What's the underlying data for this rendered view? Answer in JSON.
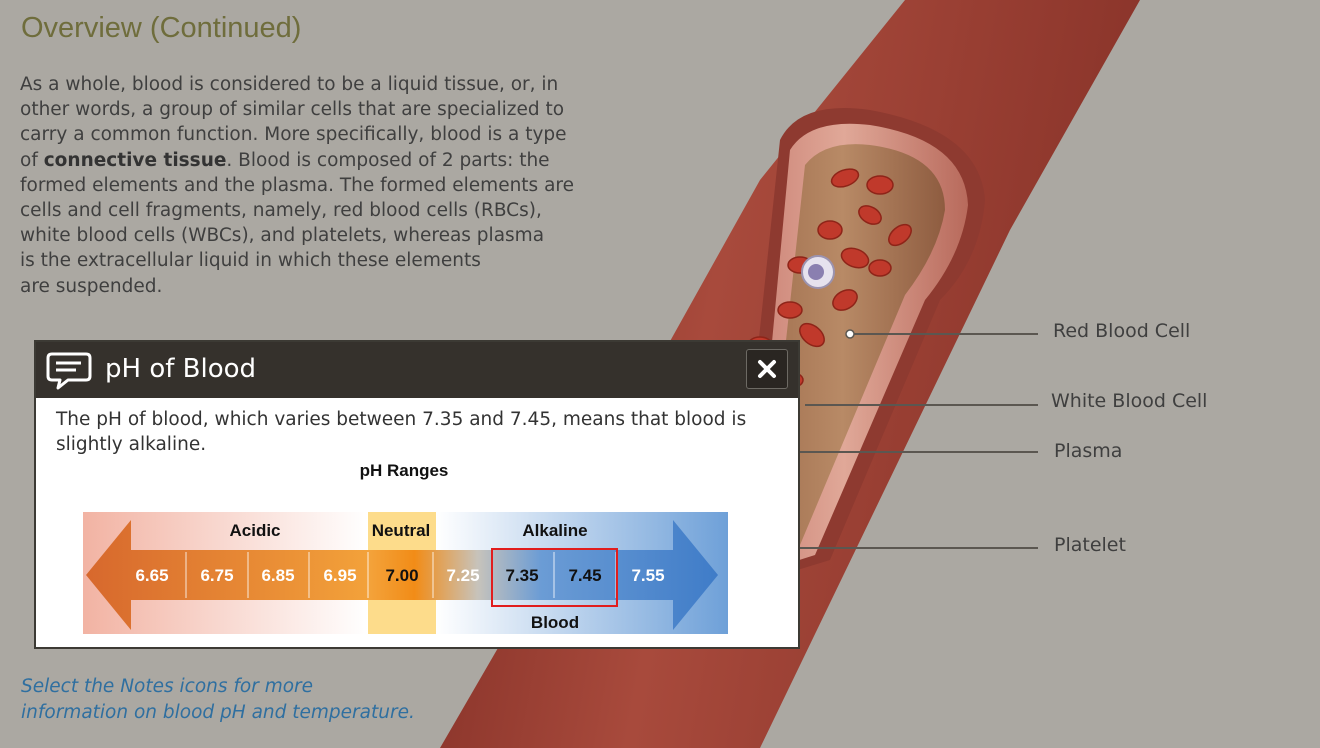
{
  "page": {
    "title": "Overview (Continued)",
    "paragraph_part1": "As a whole, blood is considered to be a liquid tissue, or, in\nother words, a group of similar cells that are specialized to\ncarry a common function. More specifically, blood is a type\nof ",
    "paragraph_bold": "connective tissue",
    "paragraph_part2": ". Blood is composed of 2 parts: the\nformed elements and the plasma. The formed elements are\ncells and cell fragments, namely, red blood cells (RBCs),\nwhite blood cells (WBCs), and platelets, whereas plasma\nis the extracellular liquid in which these elements\nare suspended.",
    "hint": "Select the Notes icons for more\ninformation on blood pH and temperature."
  },
  "illustration": {
    "labels": {
      "rbc": "Red Blood Cell",
      "wbc": "White Blood Cell",
      "plasma": "Plasma",
      "platelet": "Platelet"
    }
  },
  "popup": {
    "title": "pH of Blood",
    "icon": "notes-icon",
    "close_icon": "close-icon",
    "text": "The pH of blood, which varies between 7.35 and 7.45, means that blood is slightly alkaline.",
    "chart_title": "pH Ranges",
    "labels": {
      "acidic": "Acidic",
      "neutral": "Neutral",
      "alkaline": "Alkaline",
      "blood": "Blood"
    },
    "values": [
      "6.65",
      "6.75",
      "6.85",
      "6.95",
      "7.00",
      "7.25",
      "7.35",
      "7.45",
      "7.55"
    ]
  },
  "colors": {
    "background": "#aba8a2",
    "title": "#6f6d3c",
    "hint": "#2f6fa0",
    "popup_header": "#35312c",
    "acidic": "#d7682d",
    "neutral": "#fddc8b",
    "alkaline": "#3f7cc8",
    "blood_highlight": "#e11d1d"
  }
}
